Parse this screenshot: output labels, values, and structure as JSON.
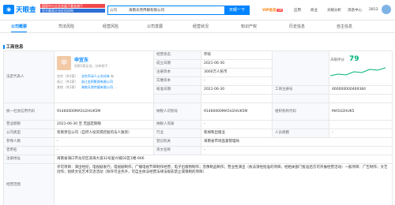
{
  "header": {
    "logo_text": "天眼查",
    "gov_tag_line1": "国家中小企业发展子基金旗下",
    "gov_tag_line2": "官方备案企业征信机构",
    "search_type": "公司",
    "search_value": "海南天然传媒有限公司",
    "search_button": "天眼一下",
    "vip_label": "VIP会员",
    "vip_badge": "VIP",
    "link_app": "应用",
    "link_product": "商业",
    "link_report": "天眼分析",
    "link_messages": "消息中心",
    "user_id": "2813"
  },
  "tabs": [
    {
      "label": "公司概要",
      "count": ""
    },
    {
      "label": "司法风险",
      "count": ""
    },
    {
      "label": "经营风险",
      "count": ""
    },
    {
      "label": "公司发展",
      "count": ""
    },
    {
      "label": "经营状况",
      "count": ""
    },
    {
      "label": "知识产权",
      "count": ""
    },
    {
      "label": "历史信息",
      "count": ""
    },
    {
      "label": "自主信息",
      "count": ""
    }
  ],
  "section_title": "工商信息",
  "legal": {
    "label": "法定代表人",
    "avatar_char": "申",
    "name": "申宜东",
    "sub": "任职1家企业，分布如下",
    "rows": [
      {
        "loc": "北京（共1家）",
        "company": "北京声动人心文化有",
        "extra": "有"
      },
      {
        "loc": "浙江（共1家）",
        "company": "浙江金桥影视有限公司",
        "extra": ""
      },
      {
        "loc": "其他（共1家）",
        "company": "海南天然传媒有限公司",
        "extra": "..."
      }
    ]
  },
  "fields": {
    "status_label": "经营状态",
    "status_value": "存续",
    "established_label": "成立日期",
    "established_value": "2021-06-30",
    "reg_capital_label": "注册资本",
    "reg_capital_value": "3000万人民币",
    "paid_capital_label": "实缴资本",
    "paid_capital_value": "-",
    "approve_label": "核准日期",
    "approve_value": "2021-06-30",
    "score_label": "天眼评分",
    "score_value": "79",
    "reg_no_label": "工商注册号",
    "reg_no_value": "460000000469384",
    "credit_label": "统一社会信用代码",
    "credit_value": "91460000MA5U2HUK5M",
    "tax_no_label": "纳税人识别号",
    "tax_no_value": "91460000MA5U2HUK5M",
    "org_code_label": "组织机构代码",
    "org_code_value": "MA5U2HUK5",
    "term_label": "营业期限",
    "term_value": "2021-06-30 至 无固定期限",
    "taxpayer_label": "纳税人资质",
    "taxpayer_value": "-",
    "type_label": "公司类型",
    "type_value": "有限责任公司（自然人投资或控股的法人独资）",
    "industry_label": "行业",
    "industry_value": "新闻和出版业",
    "staff_label": "人员规模",
    "staff_value": "-",
    "insured_label": "参保人数",
    "insured_value": "-",
    "authority_label": "登记机关",
    "authority_value": "海南省市场监督管理局",
    "former_label": "曾用名",
    "former_value": "-",
    "en_label": "英文名称",
    "en_value": "-",
    "address_label": "注册地址",
    "address_value": "海南省海口市龙华区滨海大道32号复兴城D2区1楼-666",
    "scope_label": "经营范围",
    "scope_value": "许可项目：演出经纪；电视剧发行；电视剧制作；广播电视节目制作经营；电子出版物制作；音像制品制作；营业性演出（依法须经批准的项目，经相关部门批准后方可开展经营活动）一般项目：广告制作；文艺创作；组织文化艺术交流活动（除许可业务外，可自主依法经营法律法规非禁止或限制的项目）"
  }
}
